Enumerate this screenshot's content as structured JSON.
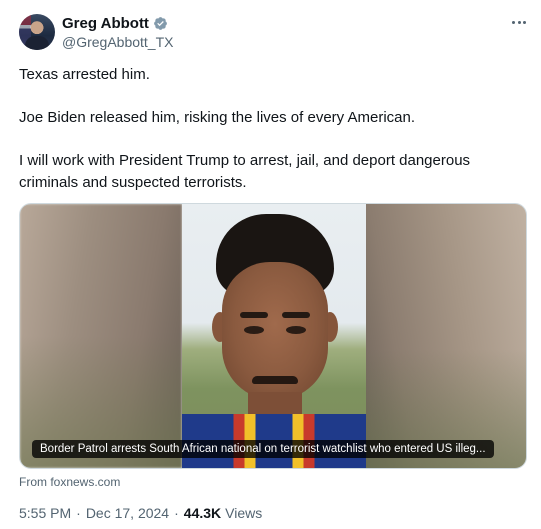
{
  "author": {
    "display_name": "Greg Abbott",
    "handle": "@GregAbbott_TX",
    "verified_icon": "verified-badge-icon",
    "verified_color": "#829aab"
  },
  "tweet": {
    "paragraphs": [
      "Texas arrested him.",
      "Joe Biden released him, risking the lives of every American.",
      "I will work with President Trump to arrest, jail, and deport dangerous criminals and suspected terrorists."
    ]
  },
  "media": {
    "caption": "Border Patrol arrests South African national on terrorist watchlist who entered US illeg..."
  },
  "source": "From foxnews.com",
  "meta": {
    "time": "5:55 PM",
    "separator": "·",
    "date": "Dec 17, 2024",
    "views_count": "44.3K",
    "views_label": "Views"
  },
  "colors": {
    "text_primary": "#0f1419",
    "text_secondary": "#536471"
  }
}
